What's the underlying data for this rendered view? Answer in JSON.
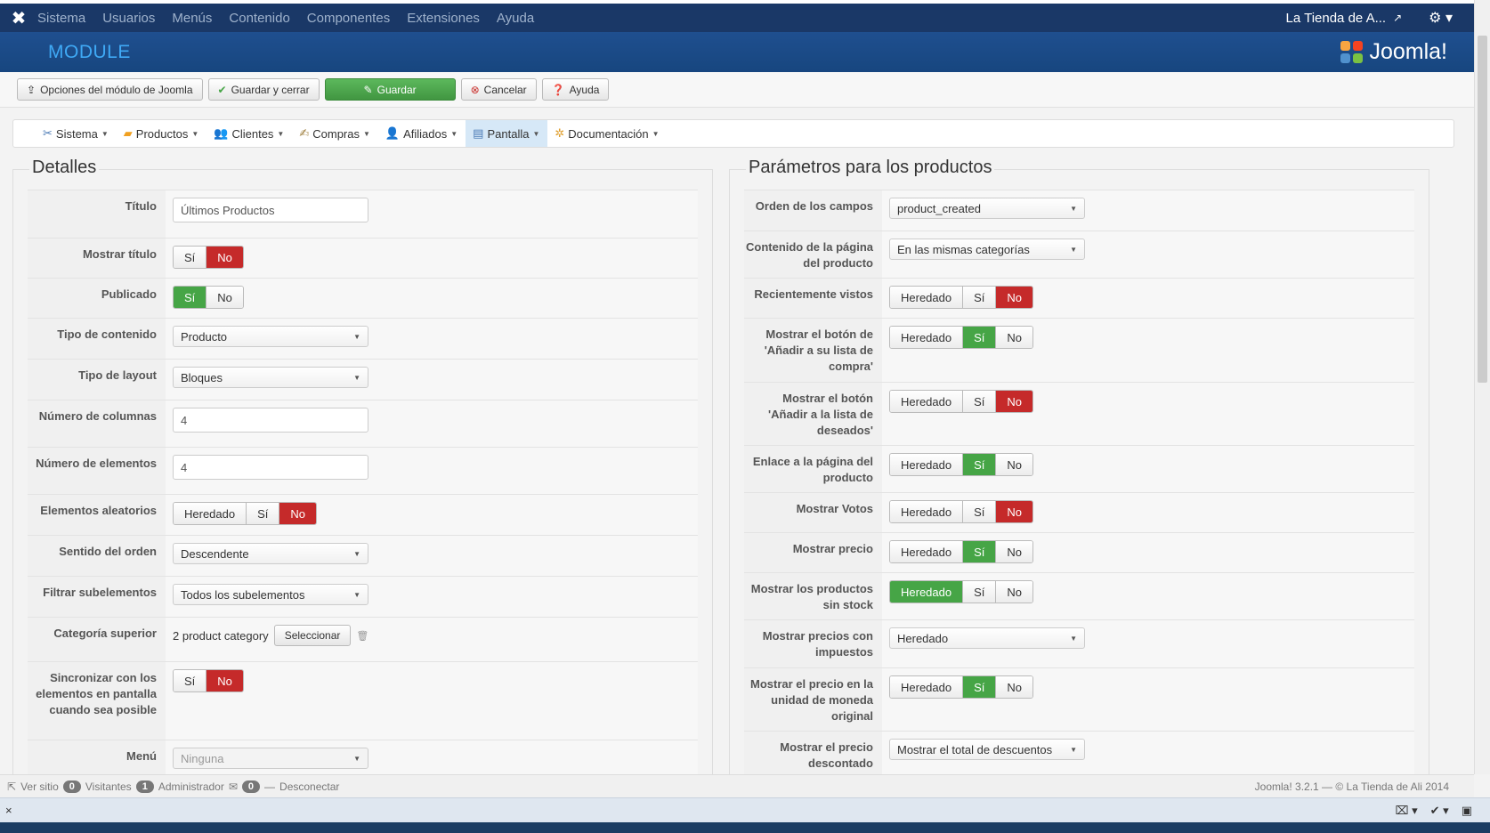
{
  "topnav": {
    "items": [
      "Sistema",
      "Usuarios",
      "Menús",
      "Contenido",
      "Componentes",
      "Extensiones",
      "Ayuda"
    ],
    "site_link": "La Tienda de A...",
    "logo_icon": "joomla-x-icon"
  },
  "header": {
    "title": "MODULE",
    "brand": "Joomla!"
  },
  "toolbar": {
    "options_label": "Opciones del módulo de Joomla",
    "save_close_label": "Guardar y cerrar",
    "save_label": "Guardar",
    "cancel_label": "Cancelar",
    "help_label": "Ayuda"
  },
  "submenu": {
    "items": [
      {
        "label": "Sistema",
        "icon": "tools-icon"
      },
      {
        "label": "Productos",
        "icon": "products-icon"
      },
      {
        "label": "Clientes",
        "icon": "users-icon"
      },
      {
        "label": "Compras",
        "icon": "orders-icon"
      },
      {
        "label": "Afiliados",
        "icon": "affiliates-icon"
      },
      {
        "label": "Pantalla",
        "icon": "display-icon",
        "active": true
      },
      {
        "label": "Documentación",
        "icon": "docs-icon"
      }
    ]
  },
  "details": {
    "legend": "Detalles",
    "titulo_label": "Título",
    "titulo_value": "Últimos Productos",
    "mostrar_titulo_label": "Mostrar título",
    "publicado_label": "Publicado",
    "tipo_contenido_label": "Tipo de contenido",
    "tipo_contenido_value": "Producto",
    "tipo_layout_label": "Tipo de layout",
    "tipo_layout_value": "Bloques",
    "num_columnas_label": "Número de columnas",
    "num_columnas_value": "4",
    "num_elementos_label": "Número de elementos",
    "num_elementos_value": "4",
    "aleatorios_label": "Elementos aleatorios",
    "sentido_label": "Sentido del orden",
    "sentido_value": "Descendente",
    "filtrar_label": "Filtrar subelementos",
    "filtrar_value": "Todos los subelementos",
    "categoria_label": "Categoría superior",
    "categoria_value": "2 product category",
    "seleccionar_label": "Seleccionar",
    "sincronizar_label": "Sincronizar con los elementos en pantalla cuando sea posible",
    "menu_label": "Menú",
    "menu_value": "Ninguna"
  },
  "toggle": {
    "si": "Sí",
    "no": "No",
    "heredado": "Heredado"
  },
  "params": {
    "legend": "Parámetros para los productos",
    "orden_label": "Orden de los campos",
    "orden_value": "product_created",
    "contenido_label": "Contenido de la página del producto",
    "contenido_value": "En las mismas categorías",
    "recientes_label": "Recientemente vistos",
    "boton_compra_label": "Mostrar el botón de 'Añadir a su lista de compra'",
    "boton_deseados_label": "Mostrar el botón 'Añadir a la lista de deseados'",
    "enlace_label": "Enlace a la página del producto",
    "votos_label": "Mostrar Votos",
    "precio_label": "Mostrar precio",
    "sin_stock_label": "Mostrar los productos sin stock",
    "impuestos_label": "Mostrar precios con impuestos",
    "impuestos_value": "Heredado",
    "moneda_label": "Mostrar el precio en la unidad de moneda original",
    "descontado_label": "Mostrar el precio descontado",
    "descontado_value": "Mostrar el total de descuentos"
  },
  "status": {
    "ver_sitio": "Ver sitio",
    "visitantes_count": "0",
    "visitantes": "Visitantes",
    "admin_count": "1",
    "admin": "Administrador",
    "msg_count": "0",
    "desconectar": "Desconectar",
    "footer": "Joomla! 3.2.1 — © La Tienda de Ali 2014"
  },
  "browser_bar": {
    "close": "×"
  }
}
